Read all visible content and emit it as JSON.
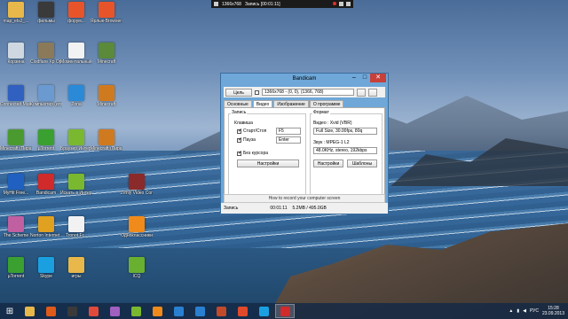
{
  "recording_bar": {
    "resolution": "1366x768",
    "status": "Запись [00:01:11]"
  },
  "desktop_icons": [
    {
      "label": "map_ets2_...",
      "icon": "folder-icon",
      "color": "#e8b84a"
    },
    {
      "label": "фильмы",
      "icon": "video-icon",
      "color": "#3a3a3a"
    },
    {
      "label": "форум...",
      "icon": "app-icon",
      "color": "#e8542a"
    },
    {
      "label": "Ярлык-Browser-Ga...",
      "icon": "app-icon",
      "color": "#e8542a"
    },
    {
      "label": "Корзина",
      "icon": "recycle-bin-icon",
      "color": "#cfd8e0"
    },
    {
      "label": "Clodflare Xp Opera Ex...",
      "icon": "app-icon",
      "color": "#8a7a5a"
    },
    {
      "label": "Моментальный Ярлык",
      "icon": "app-icon",
      "color": "#f2f2f2"
    },
    {
      "label": "Minecraft",
      "icon": "minecraft-icon",
      "color": "#5a8a3a"
    },
    {
      "label": "Connected Music po...",
      "icon": "music-icon",
      "color": "#3060c0"
    },
    {
      "label": "Компьютер (игры)",
      "icon": "computer-icon",
      "color": "#6a9ad0"
    },
    {
      "label": "Zona",
      "icon": "zona-icon",
      "color": "#2a8ad8"
    },
    {
      "label": "Minecraft",
      "icon": "minecraft-icon",
      "color": "#d07a20"
    },
    {
      "label": "Minecraft (Пиратка)",
      "icon": "minecraft-icon",
      "color": "#4a9a30"
    },
    {
      "label": "µTorrent",
      "icon": "utorrent-icon",
      "color": "#3aa030"
    },
    {
      "label": "Браузер Интернет",
      "icon": "browser-icon",
      "color": "#7ab830"
    },
    {
      "label": "Minecraft (Пиратка)",
      "icon": "minecraft-icon",
      "color": "#d07a20"
    },
    {
      "label": "MyHit Free...",
      "icon": "app-icon",
      "color": "#2060c0"
    },
    {
      "label": "Bandicam",
      "icon": "bandicam-icon",
      "color": "#d02a2a"
    },
    {
      "label": "Искать в Интернете",
      "icon": "search-web-icon",
      "color": "#7ab830"
    },
    {
      "label": "Zenly Video Converter",
      "icon": "app-icon",
      "color": "#8a2a2a"
    },
    {
      "label": "The Scheme",
      "icon": "app-icon",
      "color": "#c060a0"
    },
    {
      "label": "Norton Internet...",
      "icon": "globe-icon",
      "color": "#e0a020"
    },
    {
      "label": "Tronot Fr...",
      "icon": "file-icon",
      "color": "#f2f2f2"
    },
    {
      "label": "Одноклассники",
      "icon": "ok-icon",
      "color": "#f08a1a"
    },
    {
      "label": "µTorrent",
      "icon": "utorrent-icon",
      "color": "#3aa030"
    },
    {
      "label": "Skype",
      "icon": "skype-icon",
      "color": "#1aa0e0"
    },
    {
      "label": "игры",
      "icon": "folder-icon",
      "color": "#e8b84a"
    },
    {
      "label": "ICQ",
      "icon": "icq-icon",
      "color": "#6ab030"
    },
    {
      "label": "Fraps",
      "icon": "fraps-icon",
      "color": "#f0d020"
    },
    {
      "label": "...",
      "icon": "disc-icon",
      "color": "#d0d0d0"
    }
  ],
  "window": {
    "title": "Bandicam",
    "target_button": "Цель",
    "area": "1366x768 - (0, 0), (1366, 768)",
    "tabs": [
      "Основные",
      "Видео",
      "Изображение",
      "О программе"
    ],
    "active_tab": "Видео",
    "record_group": "Запись",
    "hotkey_group": "Клавиша",
    "start_stop_label": "Старт/Стоп",
    "start_stop_key": "F5",
    "pause_label": "Пауза",
    "pause_key": "Enter",
    "no_cursor_label": "Без курсора",
    "settings_button": "Настройки",
    "format_group": "Формат",
    "video_label": "Видео : Xvid (VBR)",
    "video_value": "Full Size, 30.00fps, 80q",
    "audio_label": "Звук : MPEG-1 L2",
    "audio_value": "48.0KHz, stereo, 192kbps",
    "presets_button": "Шаблоны",
    "link_text": "How to record your computer screen",
    "status_label": "Запись",
    "status_time": "00:01:11",
    "status_size": "5.2MB / 495.0GB"
  },
  "taskbar": {
    "items": [
      {
        "icon": "explorer-icon",
        "color": "#e8b84a"
      },
      {
        "icon": "media-player-icon",
        "color": "#e05a1a"
      },
      {
        "icon": "film-icon",
        "color": "#3a3a3a"
      },
      {
        "icon": "chrome-icon",
        "color": "#e04a3a"
      },
      {
        "icon": "chat-icon",
        "color": "#a060c0"
      },
      {
        "icon": "bluestack-icon",
        "color": "#7ab830"
      },
      {
        "icon": "ok-icon",
        "color": "#f08a1a"
      },
      {
        "icon": "mailru-icon",
        "color": "#2a80d0"
      },
      {
        "icon": "ie-icon",
        "color": "#2a80d0"
      },
      {
        "icon": "powerpoint-icon",
        "color": "#c04a2a"
      },
      {
        "icon": "app-icon",
        "color": "#e04a2a"
      },
      {
        "icon": "skype-icon",
        "color": "#1aa0e0"
      },
      {
        "icon": "bandicam-record-icon",
        "color": "#d02a2a"
      }
    ],
    "lang": "РУС",
    "time": "15:28",
    "date": "23.09.2013"
  }
}
